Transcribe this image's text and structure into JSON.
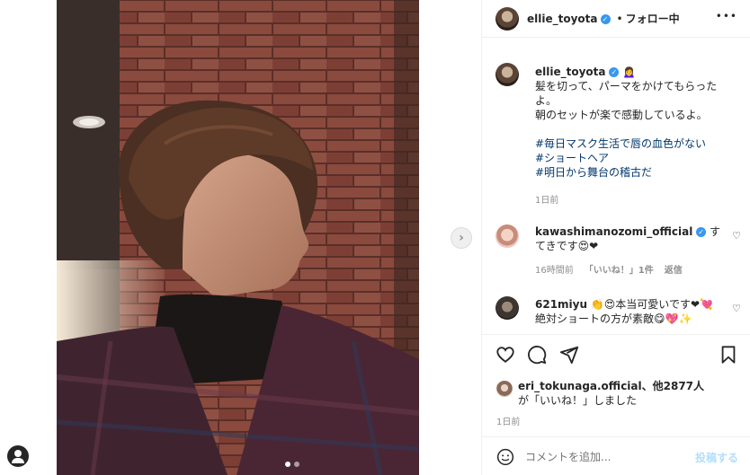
{
  "post": {
    "username": "ellie_toyota",
    "follow_status": "フォロー中",
    "more_label": "•••",
    "caption": {
      "username": "ellie_toyota",
      "emoji": "🙍‍♀️",
      "line1": "髪を切って、パーマをかけてもらったよ。",
      "line2": "朝のセットが楽で感動しているよ。",
      "hashtags": [
        "#毎日マスク生活で唇の血色がない",
        "#ショートヘア",
        "#明日から舞台の稽古だ"
      ],
      "time": "1日前"
    },
    "comments": [
      {
        "username": "kawashimanozomi_official",
        "verified": true,
        "text": "すてきです😍❤",
        "time": "16時間前",
        "likes": "「いいね！」1件",
        "reply": "返信"
      },
      {
        "username": "621miyu",
        "verified": false,
        "text_line1": "👏😍本当可愛いです❤💘",
        "text_line2": "絶対ショートの方が素敵😋💖✨"
      }
    ],
    "liked_by": {
      "prefix": "eri_tokunaga.official、他2877人",
      "suffix": "が「いいね！」しました"
    },
    "post_time": "1日前",
    "comment_placeholder": "コメントを追加...",
    "post_button": "投稿する",
    "carousel": {
      "count": 2,
      "active": 1
    }
  },
  "colors": {
    "link": "#00376b",
    "muted": "#8e8e8e",
    "verified": "#3897f0",
    "post_button": "#b2dffc"
  }
}
